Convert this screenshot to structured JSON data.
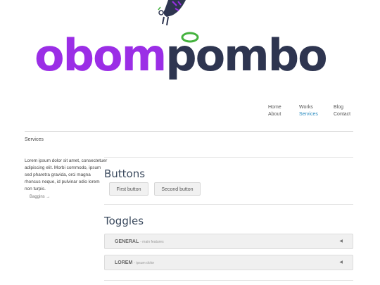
{
  "logo": {
    "part1": "obom",
    "part2": "pombo"
  },
  "nav": {
    "col1": [
      "Home",
      "About"
    ],
    "col2": [
      "Works",
      "Services"
    ],
    "col3": [
      "Blog",
      "Contact"
    ],
    "active": "Services",
    "active_color": "#2a8bbf"
  },
  "sidebar": {
    "title": "Services",
    "text": "Lorem ipsum dolor sit amet, consectetuer adipiscing elit. Morbi commodo, ipsum sed pharetra gravida, orci magna rhoncus neque, id pulvinar odio lorem non turpis.",
    "link": "Baggins →"
  },
  "buttons_section": {
    "title": "Buttons",
    "first": "First button",
    "second": "Second button"
  },
  "toggles_section": {
    "title": "Toggles",
    "items": [
      {
        "title": "GENERAL",
        "sub": "- main features"
      },
      {
        "title": "LOREM",
        "sub": "- ipsum dolor"
      }
    ]
  },
  "colors": {
    "brand_purple": "#9b2ee6",
    "brand_navy": "#2e3550",
    "swirl_green": "#44b23e"
  }
}
